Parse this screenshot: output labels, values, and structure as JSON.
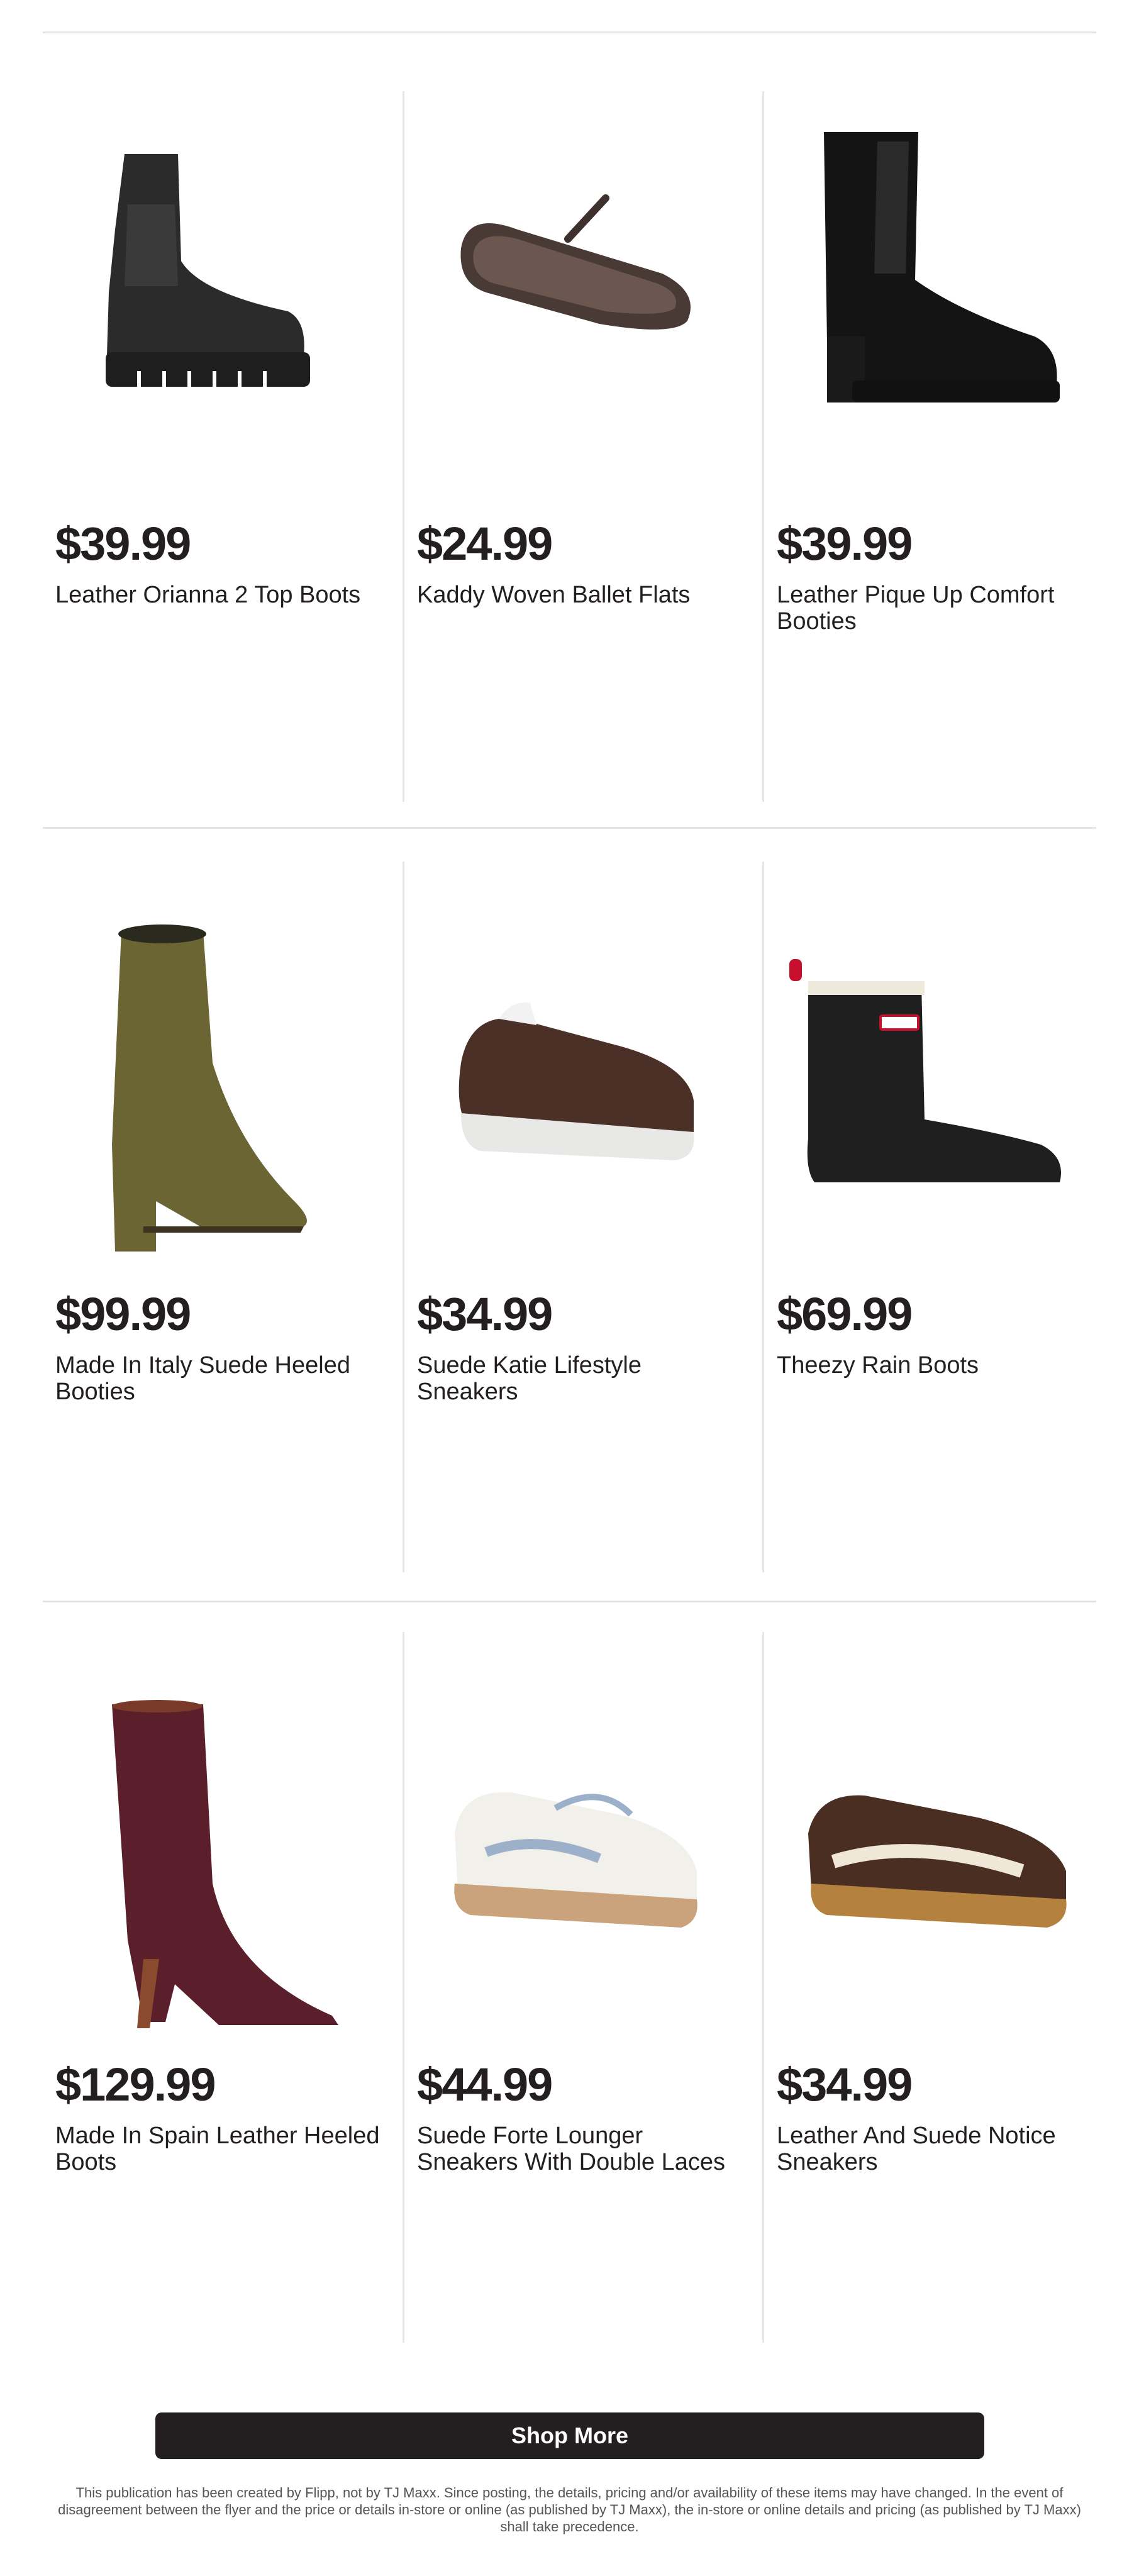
{
  "products": [
    {
      "price": "$39.99",
      "title": "Leather Orianna 2 Top Boots",
      "image": "black-lug-sole-chelsea-boot"
    },
    {
      "price": "$24.99",
      "title": "Kaddy Woven Ballet Flats",
      "image": "brown-woven-ballet-flat"
    },
    {
      "price": "$39.99",
      "title": "Leather Pique Up Comfort Booties",
      "image": "black-block-heel-chelsea-bootie"
    },
    {
      "price": "$99.99",
      "title": "Made In Italy Suede Heeled Booties",
      "image": "olive-suede-heeled-bootie"
    },
    {
      "price": "$34.99",
      "title": "Suede Katie Lifestyle Sneakers",
      "image": "brown-suede-lifestyle-sneaker"
    },
    {
      "price": "$69.99",
      "title": "Theezy Rain Boots",
      "image": "black-rain-boot"
    },
    {
      "price": "$129.99",
      "title": "Made In Spain Leather Heeled Boots",
      "image": "burgundy-croc-heeled-boot"
    },
    {
      "price": "$44.99",
      "title": "Suede Forte Lounger Sneakers With Double Laces",
      "image": "white-blue-gum-sole-sneaker"
    },
    {
      "price": "$34.99",
      "title": "Leather And Suede Notice Sneakers",
      "image": "brown-cream-gum-sole-sneaker"
    }
  ],
  "shop_more_label": "Shop More",
  "disclaimer": "This publication has been created by Flipp, not by TJ Maxx. Since posting, the details, pricing and/or availability of these items may have changed. In the event of disagreement between the flyer and the price or details in-store or online (as published by TJ Maxx), the in-store or online details and pricing (as published by TJ Maxx) shall take precedence.",
  "colors": {
    "text": "#231f20",
    "divider": "#e6e6e6",
    "button": "#231f20"
  }
}
